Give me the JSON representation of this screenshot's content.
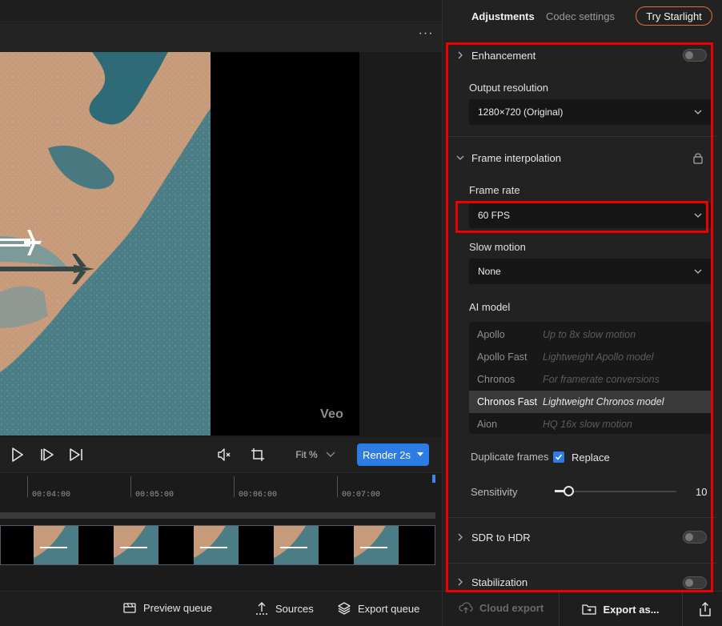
{
  "preview": {
    "watermark": "Veo"
  },
  "controls": {
    "icons": [
      "play-icon",
      "step-forward-icon",
      "skip-end-icon",
      "mute-icon",
      "crop-icon",
      "chevron-down-icon"
    ],
    "fit_label": "Fit %",
    "render_label": "Render 2s"
  },
  "timeline": {
    "ticks": [
      "00:04:00",
      "00:05:00",
      "00:06:00",
      "00:07:00"
    ]
  },
  "bottom_bar": {
    "preview_queue": "Preview queue",
    "sources": "Sources",
    "export_queue": "Export queue"
  },
  "panel": {
    "tabs": [
      "Adjustments",
      "Codec settings"
    ],
    "try_button": "Try Starlight",
    "enhancement": {
      "title": "Enhancement",
      "output_resolution_label": "Output resolution",
      "output_resolution_value": "1280×720 (Original)"
    },
    "frame_interpolation": {
      "title": "Frame interpolation",
      "frame_rate_label": "Frame rate",
      "frame_rate_value": "60 FPS",
      "slow_motion_label": "Slow motion",
      "slow_motion_value": "None",
      "ai_model_label": "AI model",
      "models": [
        {
          "name": "Apollo",
          "desc": "Up to 8x slow motion"
        },
        {
          "name": "Apollo Fast",
          "desc": "Lightweight Apollo model"
        },
        {
          "name": "Chronos",
          "desc": "For framerate conversions"
        },
        {
          "name": "Chronos Fast",
          "desc": "Lightweight Chronos model"
        },
        {
          "name": "Aion",
          "desc": "HQ 16x slow motion"
        }
      ],
      "selected_model": "Chronos Fast",
      "duplicate_frames_label": "Duplicate frames",
      "replace_label": "Replace",
      "replace_checked": true,
      "sensitivity_label": "Sensitivity",
      "sensitivity_value": "10"
    },
    "sdr_to_hdr": {
      "title": "SDR to HDR"
    },
    "stabilization": {
      "title": "Stabilization"
    },
    "footer": {
      "cloud_export": "Cloud export",
      "export_as": "Export as..."
    }
  },
  "colors": {
    "accent": "#2d7be5",
    "highlight_box": "#ee0000",
    "try_button_border": "#e0703a"
  }
}
